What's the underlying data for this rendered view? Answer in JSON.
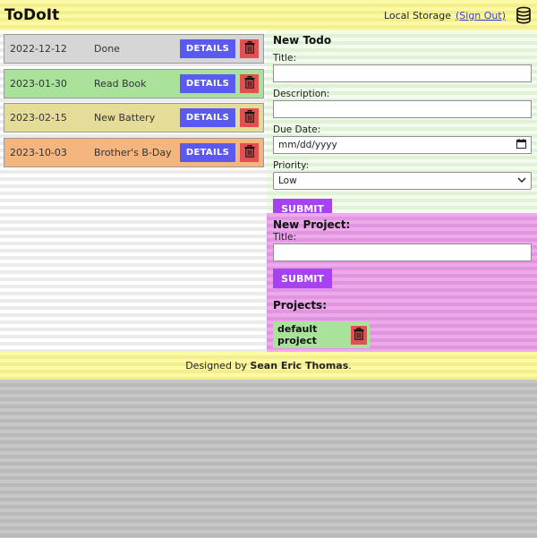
{
  "header": {
    "brand": "ToDoIt",
    "storage_label": "Local Storage",
    "signout_label": "(Sign Out)",
    "storage_icon": "database-icon"
  },
  "todos": [
    {
      "date": "2022-12-12",
      "title": "Done",
      "details_label": "DETAILS",
      "color": "#d6d6d6"
    },
    {
      "date": "2023-01-30",
      "title": "Read Book",
      "details_label": "DETAILS",
      "color": "#a9e39b"
    },
    {
      "date": "2023-02-15",
      "title": "New Battery",
      "details_label": "DETAILS",
      "color": "#e6dc9a"
    },
    {
      "date": "2023-10-03",
      "title": "Brother's B-Day",
      "details_label": "DETAILS",
      "color": "#f4b57f"
    }
  ],
  "new_todo": {
    "heading": "New Todo",
    "title_label": "Title:",
    "description_label": "Description:",
    "due_label": "Due Date:",
    "due_placeholder": "mm/dd/yyyy",
    "priority_label": "Priority:",
    "priority_value": "Low",
    "submit_label": "SUBMIT"
  },
  "new_project": {
    "heading": "New Project:",
    "title_label": "Title:",
    "submit_label": "SUBMIT",
    "projects_heading": "Projects:",
    "projects": [
      {
        "name": "default project"
      }
    ]
  },
  "footer": {
    "prefix": "Designed by",
    "author": "Sean Eric Thomas",
    "suffix": "."
  },
  "colors": {
    "details_button": "#5a5af0",
    "delete_button": "#e05252",
    "submit_button": "#a642f2"
  }
}
